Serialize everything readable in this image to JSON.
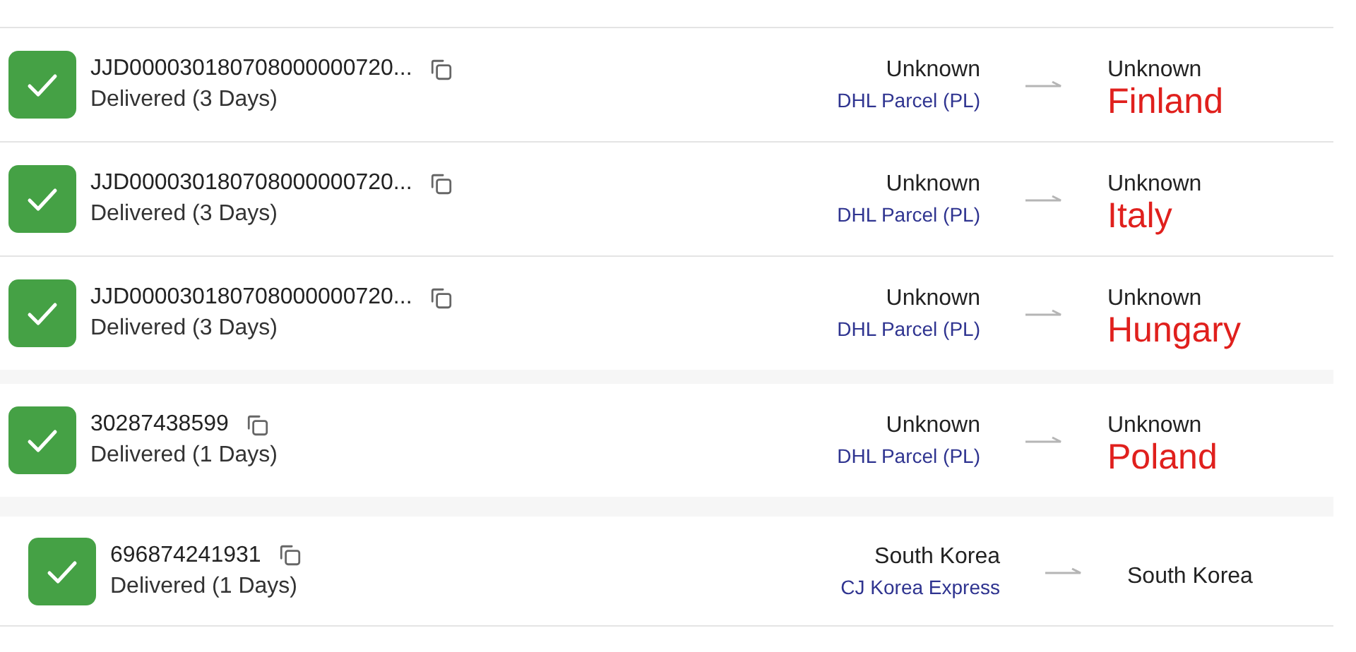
{
  "shipments": [
    {
      "tracking_number": "JJD000030180708000000720...",
      "status": "Delivered (3 Days)",
      "origin": "Unknown",
      "carrier": "DHL Parcel (PL)",
      "destination": "Unknown",
      "annotation": "Finland"
    },
    {
      "tracking_number": "JJD000030180708000000720...",
      "status": "Delivered (3 Days)",
      "origin": "Unknown",
      "carrier": "DHL Parcel (PL)",
      "destination": "Unknown",
      "annotation": "Italy"
    },
    {
      "tracking_number": "JJD000030180708000000720...",
      "status": "Delivered (3 Days)",
      "origin": "Unknown",
      "carrier": "DHL Parcel (PL)",
      "destination": "Unknown",
      "annotation": "Hungary"
    },
    {
      "tracking_number": "30287438599",
      "status": "Delivered (1 Days)",
      "origin": "Unknown",
      "carrier": "DHL Parcel (PL)",
      "destination": "Unknown",
      "annotation": "Poland"
    },
    {
      "tracking_number": "696874241931",
      "status": "Delivered (1 Days)",
      "origin": "South Korea",
      "carrier": "CJ Korea Express",
      "destination": "South Korea"
    }
  ]
}
